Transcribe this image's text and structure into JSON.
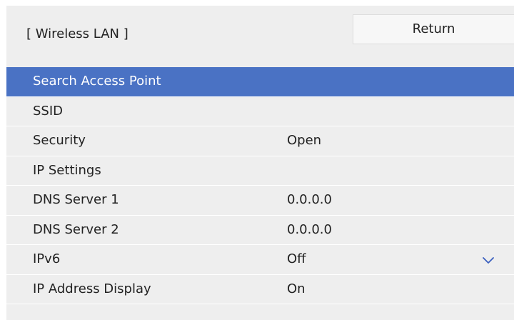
{
  "header": {
    "title": "[ Wireless LAN ]",
    "return_label": "Return"
  },
  "menu": {
    "items": [
      {
        "label": "Search Access Point",
        "value": "",
        "selected": true
      },
      {
        "label": "SSID",
        "value": ""
      },
      {
        "label": "Security",
        "value": "Open"
      },
      {
        "label": "IP Settings",
        "value": ""
      },
      {
        "label": "DNS Server 1",
        "value": "0.0.0.0"
      },
      {
        "label": "DNS Server 2",
        "value": "0.0.0.0"
      },
      {
        "label": "IPv6",
        "value": "Off"
      },
      {
        "label": "IP Address Display",
        "value": "On"
      }
    ]
  },
  "icons": {
    "scroll_down": "chevron-down-icon"
  },
  "colors": {
    "selected_row": "#4a72c4",
    "background": "#eeeeee",
    "chevron": "#3b5fbf"
  }
}
